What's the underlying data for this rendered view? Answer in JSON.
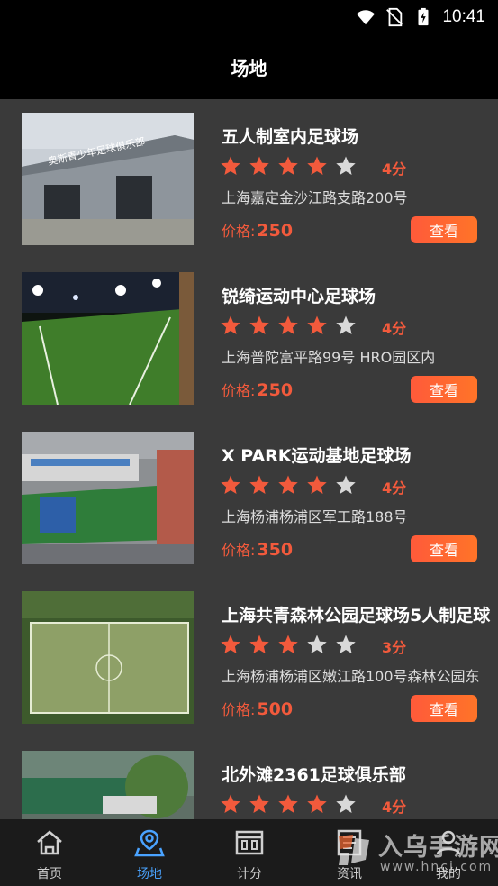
{
  "status_bar": {
    "time": "10:41"
  },
  "header": {
    "title": "场地"
  },
  "venues": [
    {
      "name": "五人制室内足球场",
      "rating": 4,
      "score_label": "4分",
      "address": "上海嘉定金沙江路支路200号",
      "price_label": "价格:",
      "price": "250",
      "button": "查看",
      "thumb_text": "奥斯青少年足球俱乐部"
    },
    {
      "name": "锐绮运动中心足球场",
      "rating": 4,
      "score_label": "4分",
      "address": "上海普陀富平路99号 HRO园区内",
      "price_label": "价格:",
      "price": "250",
      "button": "查看"
    },
    {
      "name": "X PARK运动基地足球场",
      "rating": 4,
      "score_label": "4分",
      "address": "上海杨浦杨浦区军工路188号",
      "price_label": "价格:",
      "price": "350",
      "button": "查看"
    },
    {
      "name": "上海共青森林公园足球场5人制足球",
      "rating": 3,
      "score_label": "3分",
      "address": "上海杨浦杨浦区嫩江路100号森林公园东",
      "price_label": "价格:",
      "price": "500",
      "button": "查看"
    },
    {
      "name": "北外滩2361足球俱乐部",
      "rating": 4,
      "score_label": "4分",
      "address": "",
      "price_label": "",
      "price": "",
      "button": ""
    }
  ],
  "tabbar": {
    "items": [
      {
        "label": "首页",
        "icon": "home-icon"
      },
      {
        "label": "场地",
        "icon": "venue-location-icon",
        "active": true
      },
      {
        "label": "计分",
        "icon": "scoreboard-icon"
      },
      {
        "label": "资讯",
        "icon": "news-icon"
      },
      {
        "label": "我的",
        "icon": "profile-icon"
      }
    ]
  },
  "watermark": {
    "text": "入乌手游网",
    "url": "www.hncj.com"
  },
  "colors": {
    "accent": "#f25a3c",
    "active_tab": "#4aa3ff",
    "star_on": "#f25a3c",
    "star_off": "#d9d9d9"
  }
}
